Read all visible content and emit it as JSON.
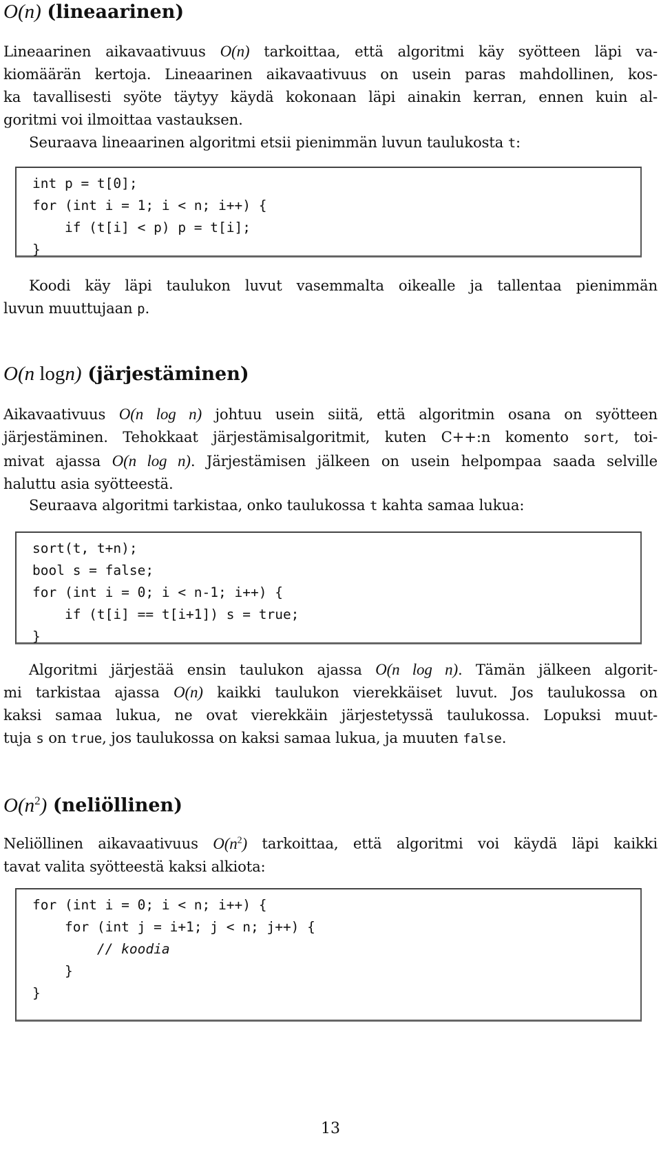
{
  "page_number": "13",
  "sections": [
    {
      "heading": {
        "math": "O(n)",
        "title": "(lineaarinen)"
      },
      "paragraphs": {
        "p1": {
          "lines": [
            [
              "Lineaarinen aikavaativuus ",
              "O(n)",
              " tarkoittaa, että algoritmi käy syötteen läpi va-"
            ],
            [
              "kiomäärän kertoja. Lineaarinen aikavaativuus on usein paras mahdollinen, kos-"
            ],
            [
              "ka tavallisesti syöte täytyy käydä kokonaan läpi ainakin kerran, ennen kuin al-"
            ],
            [
              "goritmi voi ilmoittaa vastauksen."
            ]
          ]
        },
        "p2": {
          "text": "Seuraava lineaarinen algoritmi etsii pienimmän luvun taulukosta ",
          "code": "t",
          "end": ":"
        },
        "code": [
          "int p = t[0];",
          "for (int i = 1; i < n; i++) {",
          "    if (t[i] < p) p = t[i];",
          "}"
        ],
        "p3": {
          "line1": "Koodi käy läpi taulukon luvut vasemmalta oikealle ja tallentaa pienimmän",
          "line2": "luvun muuttujaan ",
          "code": "p",
          "end": "."
        }
      }
    },
    {
      "heading": {
        "math_O": "O(",
        "math_n": "n",
        "math_log": "log",
        "math_n2": "n",
        "math_close": ")",
        "title": "(järjestäminen)"
      },
      "p1": {
        "a": "Aikavaativuus ",
        "m1": "O(n log n)",
        "b": " johtuu usein siitä, että algoritmin osana on syötteen",
        "c": "järjestäminen. Tehokkaat järjestämisalgoritmit, kuten C++:n komento ",
        "code": "sort",
        "d": ", toi-",
        "e": "mivat ajassa ",
        "m2": "O(n log n)",
        "f": ". Järjestämisen jälkeen on usein helpompaa saada selville",
        "g": "haluttu asia syötteestä."
      },
      "p2": {
        "a": "Seuraava algoritmi tarkistaa, onko taulukossa ",
        "code": "t",
        "b": " kahta samaa lukua:"
      },
      "code": [
        "sort(t, t+n);",
        "bool s = false;",
        "for (int i = 0; i < n-1; i++) {",
        "    if (t[i] == t[i+1]) s = true;",
        "}"
      ],
      "p3": {
        "a": "Algoritmi järjestää ensin taulukon ajassa ",
        "m1": "O(n log n)",
        "b": ". Tämän jälkeen algorit-",
        "c": "mi tarkistaa ajassa ",
        "m2": "O(n)",
        "d": " kaikki taulukon vierekkäiset luvut. Jos taulukossa on",
        "e": "kaksi samaa lukua, ne ovat vierekkäin järjestetyssä taulukossa. Lopuksi muut-",
        "f": "tuja ",
        "code1": "s",
        "g": " on ",
        "code2": "true",
        "h": ", jos taulukossa on kaksi samaa lukua, ja muuten ",
        "code3": "false",
        "i": "."
      }
    },
    {
      "heading": {
        "math": "O(n",
        "sup": "2",
        "close": ")",
        "title": "(neliöllinen)"
      },
      "p1": {
        "a": "Neliöllinen aikavaativuus ",
        "m_open": "O(n",
        "m_sup": "2",
        "m_close": ")",
        "b": " tarkoittaa, että algoritmi voi käydä läpi kaikki",
        "c": "tavat valita syötteestä kaksi alkiota:"
      },
      "code": [
        "for (int i = 0; i < n; i++) {",
        "    for (int j = i+1; j < n; j++) {",
        "        // koodia",
        "    }",
        "}"
      ]
    }
  ]
}
